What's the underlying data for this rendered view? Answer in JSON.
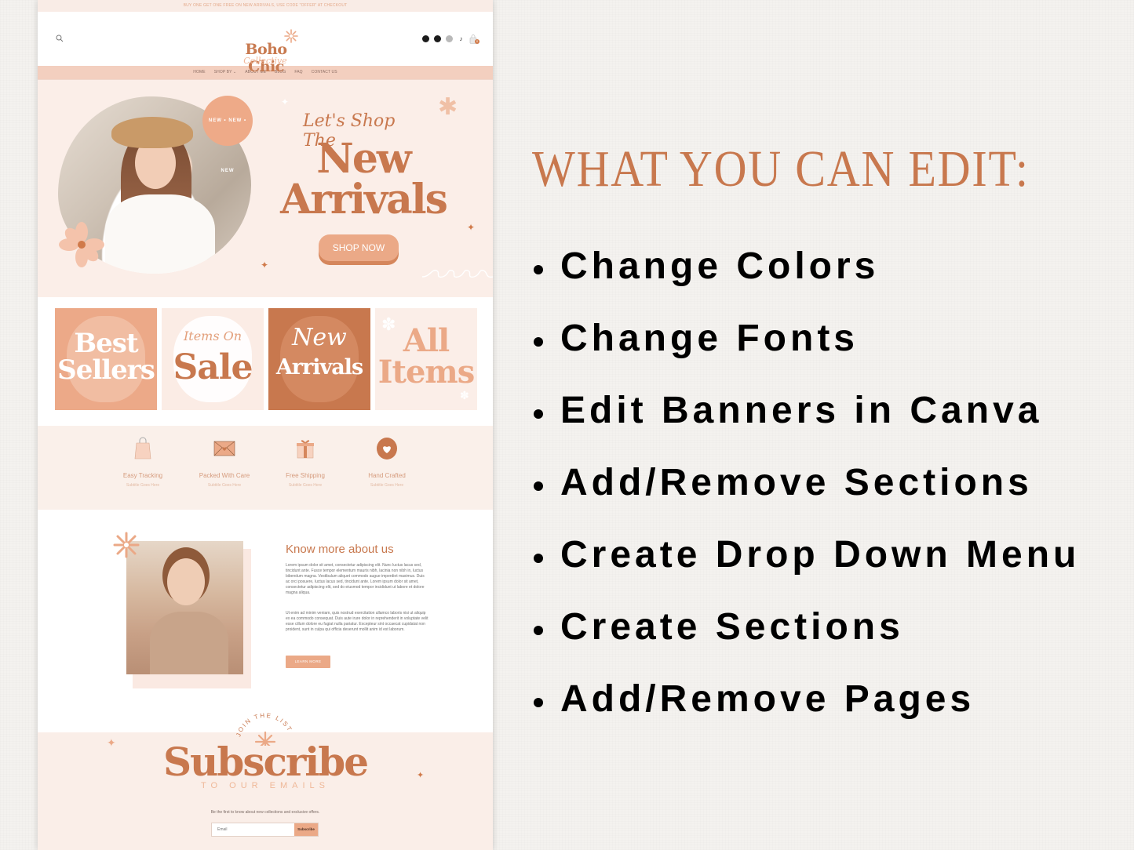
{
  "site": {
    "promo_bar": "BUY ONE GET ONE FREE ON NEW ARRIVALS, USE CODE \"OFFER\" AT CHECKOUT",
    "brand": {
      "name": "Boho Chic",
      "tagline": "Collective"
    },
    "header_icons": [
      "search-icon",
      "facebook-icon",
      "pinterest-icon",
      "instagram-icon",
      "tiktok-icon",
      "cart-icon"
    ],
    "cart_count": "0",
    "tiktok_glyph": "♪",
    "nav": [
      {
        "label": "HOME"
      },
      {
        "label": "SHOP BY ⌄"
      },
      {
        "label": "ABOUT ME"
      },
      {
        "label": "BLOG"
      },
      {
        "label": "FAQ"
      },
      {
        "label": "CONTACT US"
      }
    ],
    "hero": {
      "badge": "NEW • NEW • NEW",
      "script": "Let's Shop The",
      "title_line1": "New",
      "title_line2": "Arrivals",
      "button": "SHOP NOW"
    },
    "categories": [
      {
        "script": "",
        "line1": "Best",
        "line2": "Sellers"
      },
      {
        "script": "Items On",
        "line1": "Sale",
        "line2": ""
      },
      {
        "script": "New",
        "line1": "Arrivals",
        "line2": ""
      },
      {
        "script": "",
        "line1": "All",
        "line2": "Items"
      }
    ],
    "features": [
      {
        "title": "Easy Tracking",
        "subtitle": "Subtitle Goes Here",
        "icon": "shopping-bag-icon"
      },
      {
        "title": "Packed With Care",
        "subtitle": "Subtitle Goes Here",
        "icon": "envelope-heart-icon"
      },
      {
        "title": "Free Shipping",
        "subtitle": "Subtitle Goes Here",
        "icon": "gift-icon"
      },
      {
        "title": "Hand Crafted",
        "subtitle": "Subtitle Goes Here",
        "icon": "heart-icon"
      }
    ],
    "about": {
      "heading": "Know more about us",
      "paragraph1": "Lorem ipsum dolor sit amet, consectetur adipiscing elit. Nunc luctus lacus sed, tincidunt ante. Fusce tempor elementum mauris nibh, lacinia non nibh in, luctus bibendum magna. Vestibulum aliquet commodo augue imperdiet maximus. Duis ac orci posuere, luctus lacus sed, tincidunt ante. Lorem ipsum dolor sit amet, consectetur adipiscing elit, sed do eiusmod tempor incididunt ut labore et dolore magna aliqua.",
      "paragraph2": "Ut enim ad minim veniam, quis nostrud exercitation ullamco laboris nisi ut aliquip ex ea commodo consequat. Duis aute irure dolor in reprehenderit in voluptate velit esse cillum dolore eu fugiat nulla pariatur. Excepteur sint occaecat cupidatat non proident, sunt in culpa qui officia deserunt mollit anim id est laborum.",
      "button": "LEARN MORE"
    },
    "subscribe": {
      "arc_text": "JOIN THE LIST",
      "title": "Subscribe",
      "tagline": "TO OUR EMAILS",
      "note": "Be the first to know about new collections and exclusive offers.",
      "email_placeholder": "Email",
      "email_value": "",
      "button": "Subscribe"
    }
  },
  "panel": {
    "title": "WHAT YOU CAN EDIT:",
    "items": [
      "Change Colors",
      "Change Fonts",
      "Edit Banners in Canva",
      "Add/Remove Sections",
      "Create Drop Down Menu",
      "Create Sections",
      "Add/Remove Pages"
    ]
  },
  "colors": {
    "accent": "#c8784e",
    "peach": "#eba987",
    "blush": "#fbeee8",
    "nav_bg": "#f3cfbf",
    "text_dark": "#000000"
  }
}
